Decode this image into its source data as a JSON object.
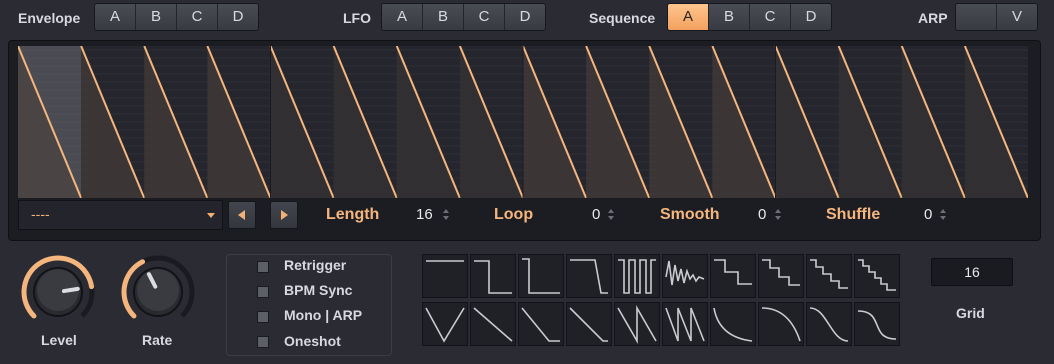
{
  "header": {
    "envelope": {
      "label": "Envelope",
      "buttons": [
        "A",
        "B",
        "C",
        "D"
      ]
    },
    "lfo": {
      "label": "LFO",
      "buttons": [
        "A",
        "B",
        "C",
        "D"
      ]
    },
    "sequence": {
      "label": "Sequence",
      "buttons": [
        "A",
        "B",
        "C",
        "D"
      ],
      "active": "A"
    },
    "arp": {
      "label": "ARP",
      "buttons": [
        "",
        "V"
      ]
    }
  },
  "sequencer": {
    "preset": "----",
    "length_label": "Length",
    "length_value": "16",
    "loop_label": "Loop",
    "loop_value": "0",
    "smooth_label": "Smooth",
    "smooth_value": "0",
    "shuffle_label": "Shuffle",
    "shuffle_value": "0",
    "steps": 16,
    "step_shape": "ramp-down"
  },
  "knobs": [
    {
      "label": "Level",
      "level": 0.8
    },
    {
      "label": "Rate",
      "level": 0.4
    }
  ],
  "options": [
    {
      "label": "Retrigger",
      "checked": false
    },
    {
      "label": "BPM Sync",
      "checked": false
    },
    {
      "label": "Mono | ARP",
      "checked": false
    },
    {
      "label": "Oneshot",
      "checked": false
    }
  ],
  "shapes": {
    "row1": [
      "flat-line",
      "square-step-down",
      "square-short",
      "trapezoid",
      "pulse-train",
      "noise",
      "stairs-3",
      "stairs-4",
      "stairs-5",
      "stairs-6"
    ],
    "row2": [
      "triangle",
      "ramp-down",
      "ramp-down-hold",
      "ramp-down-2",
      "saw-2",
      "saw-3",
      "exp-decay",
      "curve-down",
      "s-curve-down",
      "s-curve"
    ]
  },
  "grid": {
    "value": "16",
    "label": "Grid"
  },
  "colors": {
    "accent": "#f5b67e",
    "background": "#2b2c33",
    "panel": "#1c1d23"
  }
}
